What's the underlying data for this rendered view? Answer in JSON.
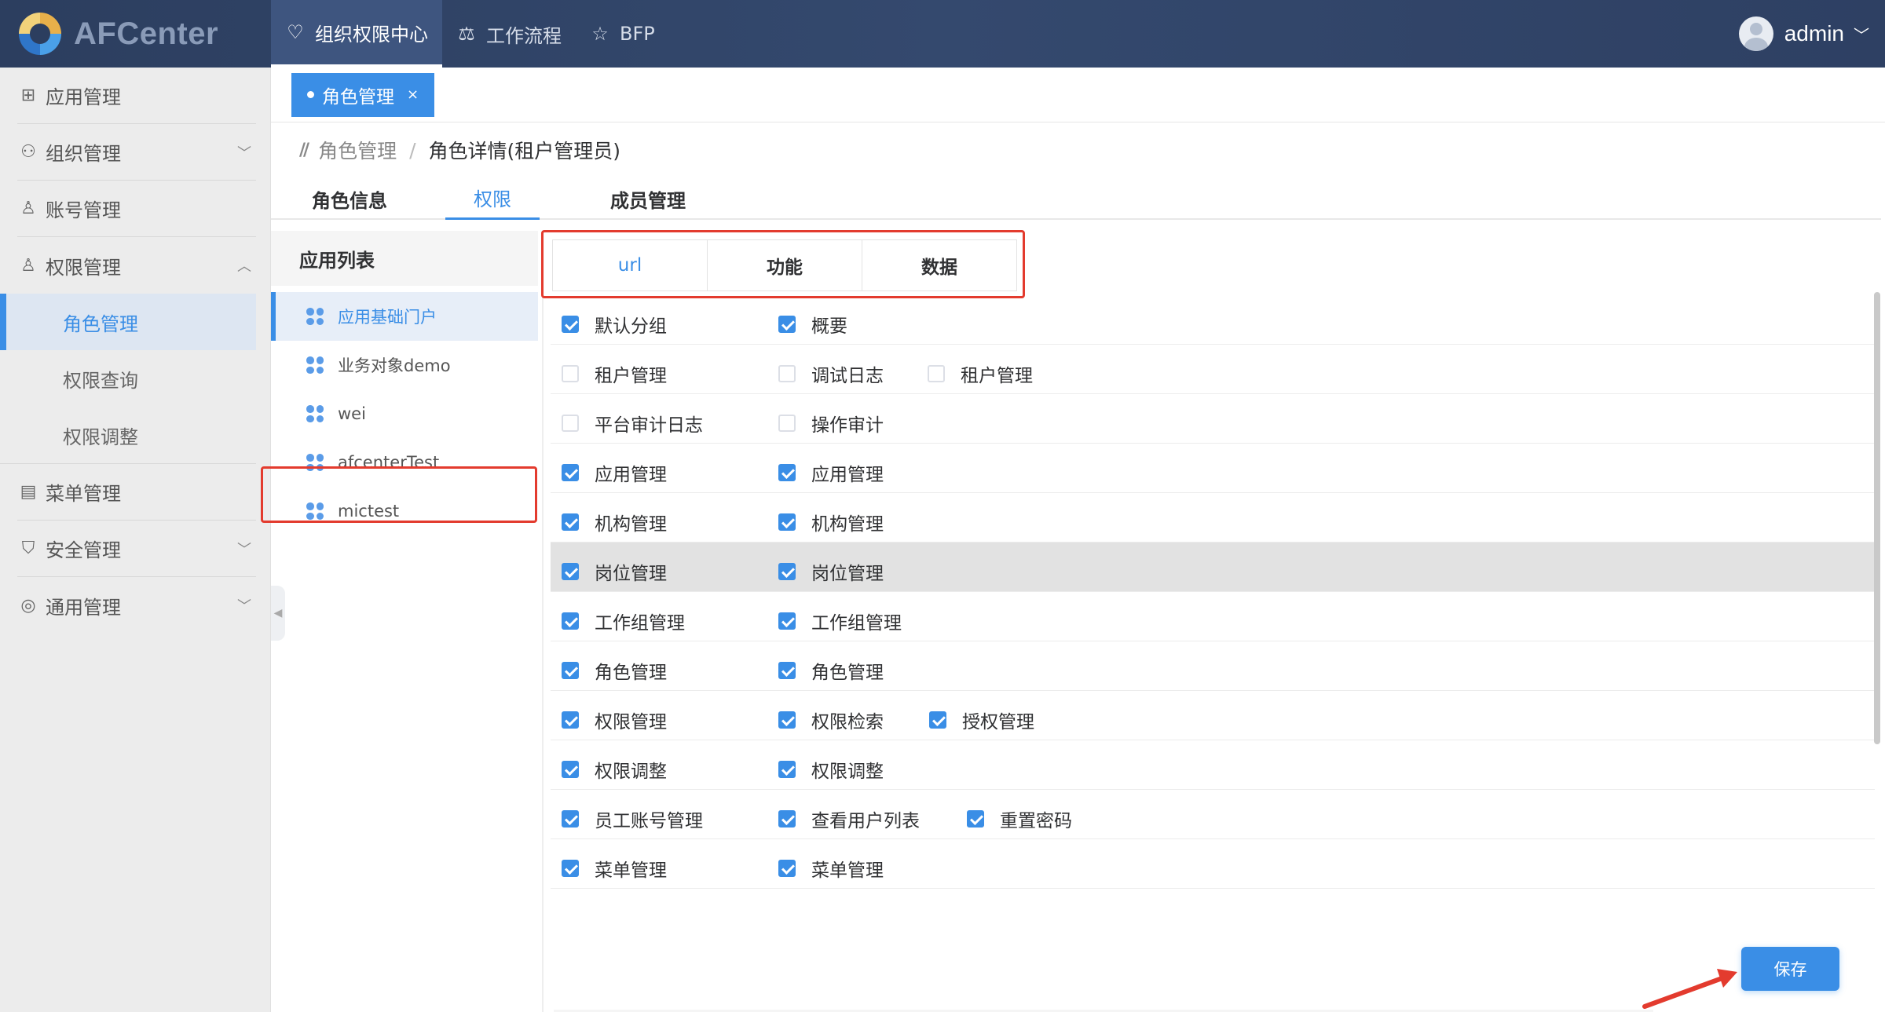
{
  "app": {
    "logo_text": "AFCenter"
  },
  "topnav": [
    {
      "label": "组织权限中心",
      "icon": "shield-heart-icon",
      "glyph": "♡"
    },
    {
      "label": "工作流程",
      "icon": "scale-icon",
      "glyph": "⚖"
    },
    {
      "label": "BFP",
      "icon": "star-icon",
      "glyph": "☆"
    }
  ],
  "user": {
    "name": "admin",
    "chevron": "﹀"
  },
  "sidebar": {
    "items": [
      {
        "label": "应用管理",
        "glyph": "⊞"
      },
      {
        "label": "组织管理",
        "glyph": "⚇",
        "arrow": "﹀"
      },
      {
        "label": "账号管理",
        "glyph": "♙"
      },
      {
        "label": "权限管理",
        "glyph": "♙",
        "arrow": "︿"
      },
      {
        "label": "菜单管理",
        "glyph": "▤"
      },
      {
        "label": "安全管理",
        "glyph": "⛉",
        "arrow": "﹀"
      },
      {
        "label": "通用管理",
        "glyph": "◎",
        "arrow": "﹀"
      }
    ],
    "sub": [
      "角色管理",
      "权限查询",
      "权限调整"
    ]
  },
  "tag": {
    "label": "角色管理",
    "close": "×"
  },
  "breadcrumb": {
    "parent": "角色管理",
    "sep": "/",
    "current": "角色详情(租户管理员)"
  },
  "tabs": [
    "角色信息",
    "权限",
    "成员管理"
  ],
  "applist": {
    "title": "应用列表",
    "items": [
      "应用基础门户",
      "业务对象demo",
      "wei",
      "afcenterTest",
      "mictest"
    ]
  },
  "subtabs": [
    "url",
    "功能",
    "数据"
  ],
  "perm_rows": [
    [
      {
        "label": "默认分组",
        "checked": true
      },
      {
        "label": "概要",
        "checked": true
      }
    ],
    [
      {
        "label": "租户管理",
        "checked": false
      },
      {
        "label": "调试日志",
        "checked": false
      },
      {
        "label": "租户管理",
        "checked": false
      }
    ],
    [
      {
        "label": "平台审计日志",
        "checked": false
      },
      {
        "label": "操作审计",
        "checked": false
      }
    ],
    [
      {
        "label": "应用管理",
        "checked": true
      },
      {
        "label": "应用管理",
        "checked": true
      }
    ],
    [
      {
        "label": "机构管理",
        "checked": true
      },
      {
        "label": "机构管理",
        "checked": true
      }
    ],
    [
      {
        "label": "岗位管理",
        "checked": true
      },
      {
        "label": "岗位管理",
        "checked": true
      }
    ],
    [
      {
        "label": "工作组管理",
        "checked": true
      },
      {
        "label": "工作组管理",
        "checked": true
      }
    ],
    [
      {
        "label": "角色管理",
        "checked": true
      },
      {
        "label": "角色管理",
        "checked": true
      }
    ],
    [
      {
        "label": "权限管理",
        "checked": true
      },
      {
        "label": "权限检索",
        "checked": true
      },
      {
        "label": "授权管理",
        "checked": true
      }
    ],
    [
      {
        "label": "权限调整",
        "checked": true
      },
      {
        "label": "权限调整",
        "checked": true
      }
    ],
    [
      {
        "label": "员工账号管理",
        "checked": true
      },
      {
        "label": "查看用户列表",
        "checked": true
      },
      {
        "label": "重置密码",
        "checked": true
      }
    ],
    [
      {
        "label": "菜单管理",
        "checked": true
      },
      {
        "label": "菜单管理",
        "checked": true
      }
    ]
  ],
  "save_label": "保存",
  "colors": {
    "accent": "#3a8ee6",
    "highlight": "#e33b2e",
    "header": "#2c3e5f"
  }
}
